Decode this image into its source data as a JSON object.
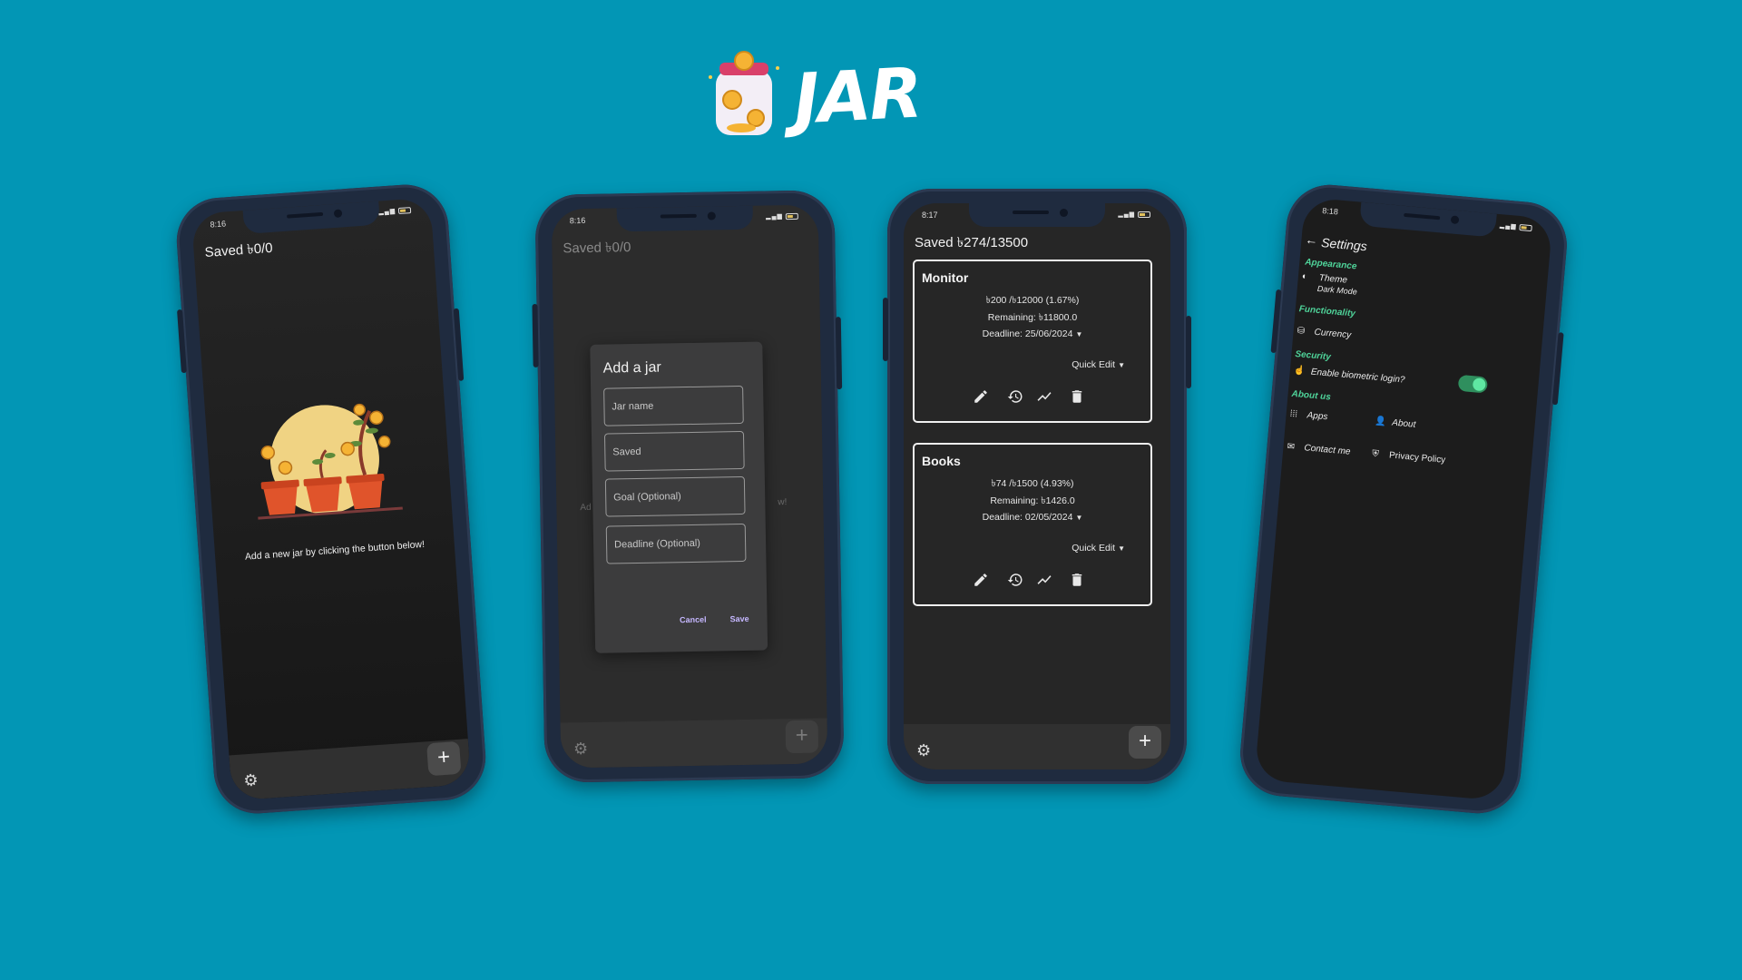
{
  "logo": {
    "text": "JAR"
  },
  "phone_empty": {
    "status_time": "8:16",
    "saved_label": "Saved ৳0/0",
    "empty_message": "Add a new jar by clicking the button below!",
    "fab_label": "+"
  },
  "phone_add": {
    "status_time": "8:16",
    "saved_label": "Saved ৳0/0",
    "ghost_left": "Ad",
    "ghost_right": "w!",
    "dialog": {
      "title": "Add a jar",
      "fields": {
        "jar_name": "Jar name",
        "saved": "Saved",
        "goal": "Goal (Optional)",
        "deadline": "Deadline (Optional)"
      },
      "cancel": "Cancel",
      "save": "Save"
    },
    "fab_label": "+"
  },
  "phone_list": {
    "status_time": "8:17",
    "saved_label": "Saved ৳274/13500",
    "jars": [
      {
        "name": "Monitor",
        "progress": "৳200 /৳12000 (1.67%)",
        "remaining": "Remaining: ৳11800.0",
        "deadline": "Deadline: 25/06/2024",
        "quick_edit": "Quick Edit"
      },
      {
        "name": "Books",
        "progress": "৳74 /৳1500 (4.93%)",
        "remaining": "Remaining: ৳1426.0",
        "deadline": "Deadline: 02/05/2024",
        "quick_edit": "Quick Edit"
      }
    ],
    "fab_label": "+"
  },
  "phone_settings": {
    "status_time": "8:18",
    "title": "Settings",
    "sections": {
      "appearance": "Appearance",
      "functionality": "Functionality",
      "security": "Security",
      "about_us": "About us"
    },
    "items": {
      "theme": "Theme",
      "theme_value": "Dark Mode",
      "currency": "Currency",
      "biometric": "Enable biometric login?",
      "apps": "Apps",
      "about": "About",
      "contact": "Contact me",
      "privacy": "Privacy Policy"
    },
    "biometric_enabled": true,
    "accent_color": "#4fd49a"
  },
  "colors": {
    "background": "#0296b5",
    "phone_frame": "#1f2b3f",
    "screen": "#262626"
  }
}
